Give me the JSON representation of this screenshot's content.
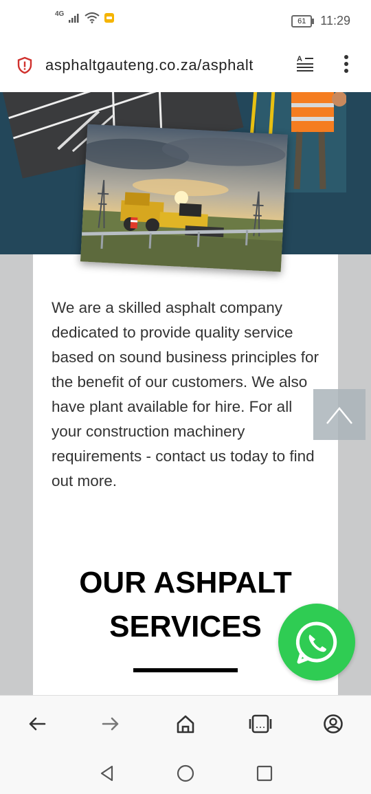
{
  "status_bar": {
    "network": "4G",
    "battery": "61",
    "time": "11:29"
  },
  "browser": {
    "url": "asphaltgauteng.co.za/asphalt"
  },
  "main": {
    "intro_text": "We are a skilled asphalt company dedicated to provide quality service based on sound business principles for the benefit of our customers. We also have plant available for hire. For all your construction machinery requirements - contact us today to find out more.",
    "section_title_line1": "OUR ASHPALT",
    "section_title_line2": "SERVICES"
  },
  "icons": {
    "toolbar": [
      "back-arrow-icon",
      "forward-arrow-icon",
      "home-icon",
      "tabs-icon",
      "account-icon"
    ],
    "system_nav": [
      "back-triangle-icon",
      "home-circle-icon",
      "recents-square-icon"
    ],
    "floating": [
      "scroll-top-icon",
      "whatsapp-icon"
    ]
  },
  "colors": {
    "hero_bg": "#23475a",
    "whatsapp": "#2fcc53",
    "shield": "#d0312d"
  }
}
